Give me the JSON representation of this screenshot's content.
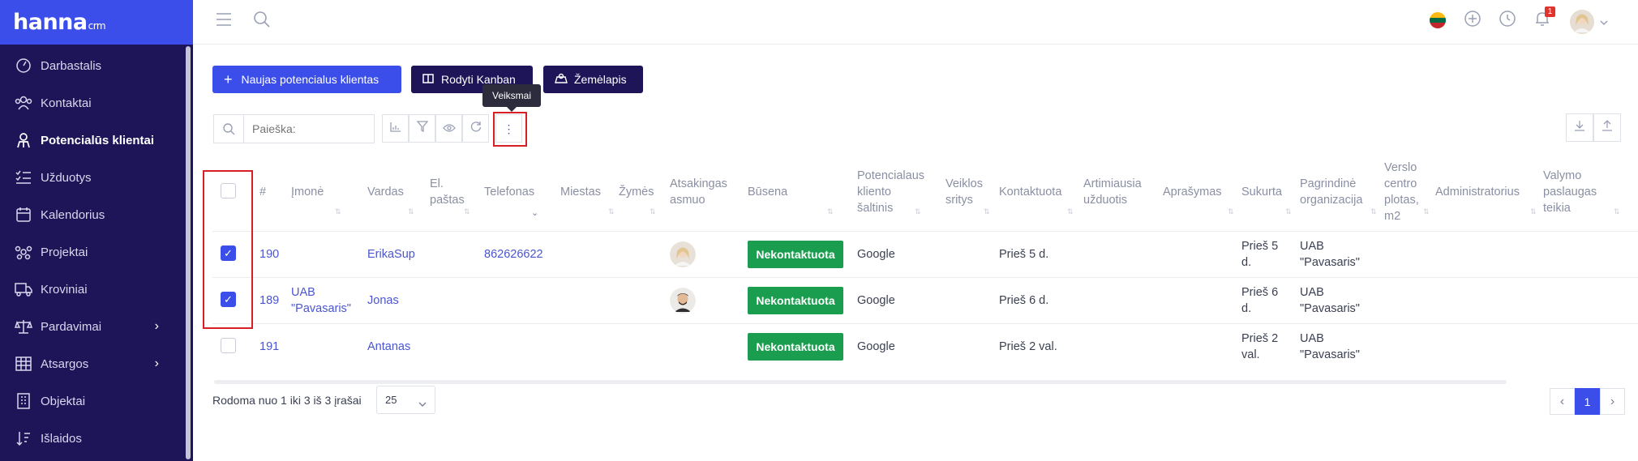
{
  "app": {
    "logo_main": "hanna",
    "logo_sub": "crm"
  },
  "sidebar": {
    "items": [
      {
        "label": "Darbastalis",
        "icon": "dashboard-icon"
      },
      {
        "label": "Kontaktai",
        "icon": "contacts-icon"
      },
      {
        "label": "Potencialūs klientai",
        "icon": "leads-icon"
      },
      {
        "label": "Užduotys",
        "icon": "tasks-icon"
      },
      {
        "label": "Kalendorius",
        "icon": "calendar-icon"
      },
      {
        "label": "Projektai",
        "icon": "projects-icon"
      },
      {
        "label": "Kroviniai",
        "icon": "truck-icon"
      },
      {
        "label": "Pardavimai",
        "icon": "scales-icon"
      },
      {
        "label": "Atsargos",
        "icon": "grid-icon"
      },
      {
        "label": "Objektai",
        "icon": "building-icon"
      },
      {
        "label": "Išlaidos",
        "icon": "sort-icon"
      }
    ],
    "expandable_arrow": "›"
  },
  "topbar": {
    "notification_count": "1"
  },
  "actions": {
    "new_lead": "Naujas potencialus klientas",
    "kanban": "Rodyti Kanban",
    "map": "Žemėlapis",
    "tooltip": "Veiksmai"
  },
  "search": {
    "placeholder": "Paieška:"
  },
  "table": {
    "headers": {
      "num": "#",
      "company": "Įmonė",
      "name": "Vardas",
      "email_1": "El.",
      "email_2": "paštas",
      "phone": "Telefonas",
      "city": "Miestas",
      "tags": "Žymės",
      "resp_1": "Atsakingas",
      "resp_2": "asmuo",
      "status": "Būsena",
      "src_1": "Potencialaus",
      "src_2": "kliento",
      "src_3": "šaltinis",
      "field_1": "Veiklos",
      "field_2": "sritys",
      "contacted": "Kontaktuota",
      "next_1": "Artimiausia",
      "next_2": "užduotis",
      "desc": "Aprašymas",
      "created": "Sukurta",
      "org_1": "Pagrindinė",
      "org_2": "organizacija",
      "area_1": "Verslo",
      "area_2": "centro",
      "area_3": "plotas,",
      "area_4": "m2",
      "admin": "Administratorius",
      "clean_1": "Valymo",
      "clean_2": "paslaugas",
      "clean_3": "teikia"
    },
    "rows": [
      {
        "id": "190",
        "company_1": "",
        "company_2": "",
        "name": "ErikaSup",
        "phone": "862626622",
        "status": "Nekontaktuota",
        "source": "Google",
        "contacted": "Prieš 5 d.",
        "created_1": "Prieš 5",
        "created_2": "d.",
        "org_1": "UAB",
        "org_2": "\"Pavasaris\""
      },
      {
        "id": "189",
        "company_1": "UAB",
        "company_2": "\"Pavasaris\"",
        "name": "Jonas",
        "phone": "",
        "status": "Nekontaktuota",
        "source": "Google",
        "contacted": "Prieš 6 d.",
        "created_1": "Prieš 6",
        "created_2": "d.",
        "org_1": "UAB",
        "org_2": "\"Pavasaris\""
      },
      {
        "id": "191",
        "company_1": "",
        "company_2": "",
        "name": "Antanas",
        "phone": "",
        "status": "Nekontaktuota",
        "source": "Google",
        "contacted": "Prieš 2 val.",
        "created_1": "Prieš 2",
        "created_2": "val.",
        "org_1": "UAB",
        "org_2": "\"Pavasaris\""
      }
    ]
  },
  "footer": {
    "summary": "Rodoma nuo 1 iki 3 iš 3 įrašai",
    "page_size": "25",
    "page": "1",
    "prev": "‹",
    "next": "›"
  }
}
